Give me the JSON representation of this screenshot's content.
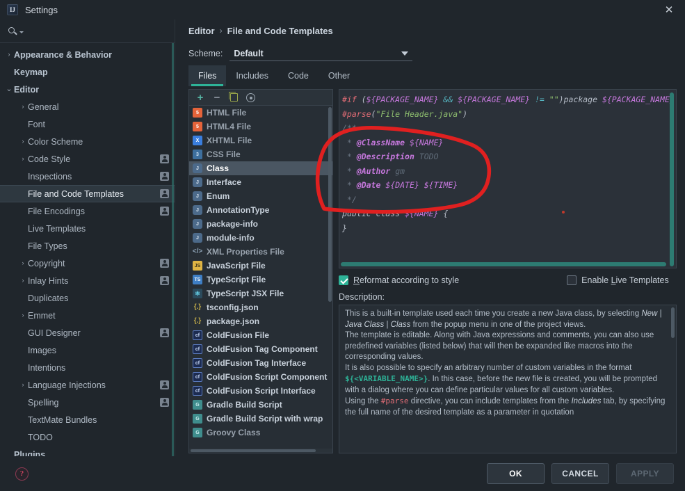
{
  "window": {
    "title": "Settings",
    "logo_text": "IJ",
    "close_icon": "close-icon"
  },
  "sidebar": {
    "search_placeholder": "",
    "search_value": "",
    "items": [
      {
        "label": "Appearance & Behavior",
        "level": 0,
        "arrow": "›",
        "badge": false,
        "selected": false
      },
      {
        "label": "Keymap",
        "level": 0,
        "arrow": "",
        "badge": false,
        "selected": false
      },
      {
        "label": "Editor",
        "level": 0,
        "arrow": "⌄",
        "badge": false,
        "selected": false
      },
      {
        "label": "General",
        "level": 1,
        "arrow": "›",
        "badge": false,
        "selected": false
      },
      {
        "label": "Font",
        "level": 1,
        "arrow": "",
        "badge": false,
        "selected": false
      },
      {
        "label": "Color Scheme",
        "level": 1,
        "arrow": "›",
        "badge": false,
        "selected": false
      },
      {
        "label": "Code Style",
        "level": 1,
        "arrow": "›",
        "badge": true,
        "selected": false
      },
      {
        "label": "Inspections",
        "level": 1,
        "arrow": "",
        "badge": true,
        "selected": false
      },
      {
        "label": "File and Code Templates",
        "level": 1,
        "arrow": "",
        "badge": true,
        "selected": true
      },
      {
        "label": "File Encodings",
        "level": 1,
        "arrow": "",
        "badge": true,
        "selected": false
      },
      {
        "label": "Live Templates",
        "level": 1,
        "arrow": "",
        "badge": false,
        "selected": false
      },
      {
        "label": "File Types",
        "level": 1,
        "arrow": "",
        "badge": false,
        "selected": false
      },
      {
        "label": "Copyright",
        "level": 1,
        "arrow": "›",
        "badge": true,
        "selected": false
      },
      {
        "label": "Inlay Hints",
        "level": 1,
        "arrow": "›",
        "badge": true,
        "selected": false
      },
      {
        "label": "Duplicates",
        "level": 1,
        "arrow": "",
        "badge": false,
        "selected": false
      },
      {
        "label": "Emmet",
        "level": 1,
        "arrow": "›",
        "badge": false,
        "selected": false
      },
      {
        "label": "GUI Designer",
        "level": 1,
        "arrow": "",
        "badge": true,
        "selected": false
      },
      {
        "label": "Images",
        "level": 1,
        "arrow": "",
        "badge": false,
        "selected": false
      },
      {
        "label": "Intentions",
        "level": 1,
        "arrow": "",
        "badge": false,
        "selected": false
      },
      {
        "label": "Language Injections",
        "level": 1,
        "arrow": "›",
        "badge": true,
        "selected": false
      },
      {
        "label": "Spelling",
        "level": 1,
        "arrow": "",
        "badge": true,
        "selected": false
      },
      {
        "label": "TextMate Bundles",
        "level": 1,
        "arrow": "",
        "badge": false,
        "selected": false
      },
      {
        "label": "TODO",
        "level": 1,
        "arrow": "",
        "badge": false,
        "selected": false
      },
      {
        "label": "Plugins",
        "level": 0,
        "arrow": "",
        "badge": false,
        "selected": false
      }
    ]
  },
  "breadcrumb": {
    "root": "Editor",
    "separator": "›",
    "current": "File and Code Templates"
  },
  "scheme": {
    "label": "Scheme:",
    "value": "Default"
  },
  "tabs": [
    {
      "label": "Files",
      "active": true
    },
    {
      "label": "Includes",
      "active": false
    },
    {
      "label": "Code",
      "active": false
    },
    {
      "label": "Other",
      "active": false
    }
  ],
  "template_toolbar": [
    {
      "name": "add-template-button",
      "icon": "plus-icon"
    },
    {
      "name": "remove-template-button",
      "icon": "minus-icon"
    },
    {
      "name": "copy-template-button",
      "icon": "copy-icon"
    },
    {
      "name": "reset-template-button",
      "icon": "reset-icon"
    }
  ],
  "template_list": [
    {
      "label": "HTML File",
      "icon": "html-icon",
      "icon_text": "5",
      "selected": false,
      "dim": true
    },
    {
      "label": "HTML4 File",
      "icon": "html-icon",
      "icon_text": "5",
      "selected": false,
      "dim": true
    },
    {
      "label": "XHTML File",
      "icon": "xhtml-icon",
      "icon_text": "X",
      "selected": false,
      "dim": true
    },
    {
      "label": "CSS File",
      "icon": "css-icon",
      "icon_text": "3",
      "selected": false,
      "dim": true
    },
    {
      "label": "Class",
      "icon": "java-icon",
      "icon_text": "J",
      "selected": true,
      "dim": false
    },
    {
      "label": "Interface",
      "icon": "java-icon",
      "icon_text": "J",
      "selected": false,
      "dim": false
    },
    {
      "label": "Enum",
      "icon": "java-icon",
      "icon_text": "J",
      "selected": false,
      "dim": false
    },
    {
      "label": "AnnotationType",
      "icon": "java-icon",
      "icon_text": "J",
      "selected": false,
      "dim": false
    },
    {
      "label": "package-info",
      "icon": "java-icon",
      "icon_text": "J",
      "selected": false,
      "dim": false
    },
    {
      "label": "module-info",
      "icon": "java-icon",
      "icon_text": "J",
      "selected": false,
      "dim": false
    },
    {
      "label": "XML Properties File",
      "icon": "xml-icon",
      "icon_text": "</>",
      "selected": false,
      "dim": true
    },
    {
      "label": "JavaScript File",
      "icon": "js-icon",
      "icon_text": "JS",
      "selected": false,
      "dim": false
    },
    {
      "label": "TypeScript File",
      "icon": "ts-icon",
      "icon_text": "TS",
      "selected": false,
      "dim": false
    },
    {
      "label": "TypeScript JSX File",
      "icon": "tsx-icon",
      "icon_text": "⚛",
      "selected": false,
      "dim": false
    },
    {
      "label": "tsconfig.json",
      "icon": "json-icon",
      "icon_text": "{.}",
      "selected": false,
      "dim": false
    },
    {
      "label": "package.json",
      "icon": "json-icon",
      "icon_text": "{.}",
      "selected": false,
      "dim": false
    },
    {
      "label": "ColdFusion File",
      "icon": "cf-icon",
      "icon_text": "cf",
      "selected": false,
      "dim": false
    },
    {
      "label": "ColdFusion Tag Component",
      "icon": "cf-icon",
      "icon_text": "cf",
      "selected": false,
      "dim": false
    },
    {
      "label": "ColdFusion Tag Interface",
      "icon": "cf-icon",
      "icon_text": "cf",
      "selected": false,
      "dim": false
    },
    {
      "label": "ColdFusion Script Component",
      "icon": "cf-icon",
      "icon_text": "cf",
      "selected": false,
      "dim": false
    },
    {
      "label": "ColdFusion Script Interface",
      "icon": "cf-icon",
      "icon_text": "cf",
      "selected": false,
      "dim": false
    },
    {
      "label": "Gradle Build Script",
      "icon": "gradle-icon",
      "icon_text": "G",
      "selected": false,
      "dim": false
    },
    {
      "label": "Gradle Build Script with wrap",
      "icon": "gradle-icon",
      "icon_text": "G",
      "selected": false,
      "dim": false
    },
    {
      "label": "Groovy Class",
      "icon": "gradle-icon",
      "icon_text": "G",
      "selected": false,
      "dim": true
    }
  ],
  "code": {
    "lines": [
      [
        {
          "t": "#if ",
          "c": "dir"
        },
        {
          "t": "(",
          "c": "plain"
        },
        {
          "t": "${PACKAGE_NAME}",
          "c": "var"
        },
        {
          "t": " && ",
          "c": "op"
        },
        {
          "t": "${PACKAGE_NAME}",
          "c": "var"
        },
        {
          "t": " != ",
          "c": "op"
        },
        {
          "t": "\"\"",
          "c": "str"
        },
        {
          "t": ")",
          "c": "plain"
        },
        {
          "t": "package ",
          "c": "plain"
        },
        {
          "t": "${PACKAGE_NAME}",
          "c": "var"
        }
      ],
      [
        {
          "t": "#parse",
          "c": "dir"
        },
        {
          "t": "(",
          "c": "plain"
        },
        {
          "t": "\"File Header.java\"",
          "c": "str"
        },
        {
          "t": ")",
          "c": "plain"
        }
      ],
      [
        {
          "t": "/**",
          "c": "cmt"
        }
      ],
      [
        {
          "t": " * ",
          "c": "cmt"
        },
        {
          "t": "@ClassName",
          "c": "doc"
        },
        {
          "t": " ",
          "c": "cmt"
        },
        {
          "t": "${NAME}",
          "c": "var"
        }
      ],
      [
        {
          "t": " * ",
          "c": "cmt"
        },
        {
          "t": "@Description",
          "c": "doc"
        },
        {
          "t": " ",
          "c": "cmt"
        },
        {
          "t": "TODO",
          "c": "todo"
        }
      ],
      [
        {
          "t": " * ",
          "c": "cmt"
        },
        {
          "t": "@Author",
          "c": "doc"
        },
        {
          "t": " ",
          "c": "cmt"
        },
        {
          "t": "gm",
          "c": "todo"
        }
      ],
      [
        {
          "t": " * ",
          "c": "cmt"
        },
        {
          "t": "@Date",
          "c": "doc"
        },
        {
          "t": " ",
          "c": "cmt"
        },
        {
          "t": "${DATE} ${TIME}",
          "c": "var"
        }
      ],
      [
        {
          "t": " */",
          "c": "cmt"
        }
      ],
      [
        {
          "t": "public class ",
          "c": "kw"
        },
        {
          "t": "${NAME}",
          "c": "var"
        },
        {
          "t": " {",
          "c": "plain"
        }
      ],
      [
        {
          "t": "}",
          "c": "plain"
        }
      ]
    ]
  },
  "options": {
    "reformat": {
      "label_pre": "R",
      "label_rest": "eformat according to style",
      "checked": true
    },
    "live_templates": {
      "label_pre_a": "Enable ",
      "label_u": "L",
      "label_rest": "ive Templates",
      "checked": false
    }
  },
  "description": {
    "label": "Description:",
    "paragraphs": [
      "This is a built-in template used each time you create a new Java class, by selecting New | Java Class | Class from the popup menu in one of the project views.",
      "The template is editable. Along with Java expressions and comments, you can also use predefined variables (listed below) that will then be expanded like macros into the corresponding values.",
      "It is also possible to specify an arbitrary number of custom variables in the format ${<VARIABLE_NAME>}. In this case, before the new file is created, you will be prompted with a dialog where you can define particular values for all custom variables.",
      "Using the #parse directive, you can include templates from the Includes tab, by specifying the full name of the desired template as a parameter in quotation"
    ]
  },
  "footer": {
    "help_icon": "help-icon",
    "help_glyph": "?",
    "buttons": [
      {
        "label": "OK",
        "state": "primary"
      },
      {
        "label": "CANCEL",
        "state": "normal"
      },
      {
        "label": "APPLY",
        "state": "disabled"
      }
    ]
  },
  "annotation": {
    "color": "#e02020",
    "shape": "hand-drawn-oval",
    "dot_color": "#c0392b"
  }
}
